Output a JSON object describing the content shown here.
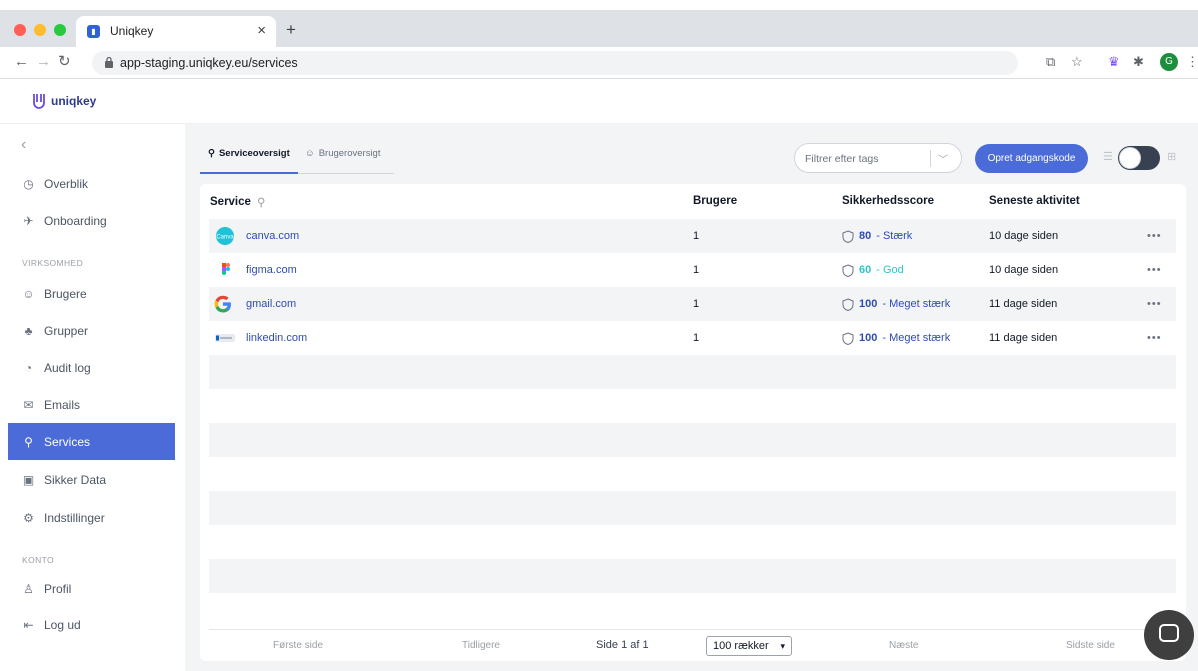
{
  "browser": {
    "tab_title": "Uniqkey",
    "tab_favicon": "favicon-icon",
    "url": "app-staging.uniqkey.eu/services",
    "profile_initial": "G"
  },
  "app": {
    "logo_text": "uniqkey"
  },
  "sidebar": {
    "collapse_icon": "chevron-left-icon",
    "items_top": [
      {
        "label": "Overblik",
        "icon": "gauge-icon"
      },
      {
        "label": "Onboarding",
        "icon": "rocket-icon"
      }
    ],
    "section_company": "VIRKSOMHED",
    "items_company": [
      {
        "label": "Brugere",
        "icon": "users-icon"
      },
      {
        "label": "Grupper",
        "icon": "group-icon"
      },
      {
        "label": "Audit log",
        "icon": "clock-icon"
      },
      {
        "label": "Emails",
        "icon": "mail-icon"
      },
      {
        "label": "Services",
        "icon": "key-icon",
        "active": true
      },
      {
        "label": "Sikker Data",
        "icon": "safe-icon"
      },
      {
        "label": "Indstillinger",
        "icon": "gear-icon"
      }
    ],
    "section_account": "KONTO",
    "items_account": [
      {
        "label": "Profil",
        "icon": "user-icon"
      },
      {
        "label": "Log ud",
        "icon": "logout-icon"
      }
    ]
  },
  "main": {
    "tabs": [
      {
        "label": "Serviceoversigt",
        "active": true
      },
      {
        "label": "Brugeroversigt",
        "active": false
      }
    ],
    "filter_placeholder": "Filtrer efter tags",
    "create_button": "Opret adgangskode",
    "table": {
      "columns": [
        "Service",
        "Brugere",
        "Sikkerhedsscore",
        "Seneste aktivitet"
      ],
      "rows": [
        {
          "service": "canva.com",
          "icon": "canva-logo-icon",
          "users": "1",
          "score": "80",
          "score_label": " - Stærk",
          "score_color": "#2f4bb5",
          "activity": "10 dage siden"
        },
        {
          "service": "figma.com",
          "icon": "figma-logo-icon",
          "users": "1",
          "score": "60",
          "score_label": " - God",
          "score_color": "#2fc6c6",
          "activity": "10 dage siden"
        },
        {
          "service": "gmail.com",
          "icon": "google-logo-icon",
          "users": "1",
          "score": "100",
          "score_label": " - Meget stærk",
          "score_color": "#2f4bb5",
          "activity": "11 dage siden"
        },
        {
          "service": "linkedin.com",
          "icon": "linkedin-logo-icon",
          "users": "1",
          "score": "100",
          "score_label": " - Meget stærk",
          "score_color": "#2f4bb5",
          "activity": "11 dage siden"
        }
      ]
    },
    "pagination": {
      "first": "Første side",
      "prev": "Tidligere",
      "page_info": "Side 1 af 1",
      "per_page": "100 rækker",
      "next": "Næste",
      "last": "Sidste side"
    }
  },
  "colors": {
    "accent": "#4a6bd8",
    "link": "#2f4bb5",
    "good": "#2fc6c6"
  }
}
